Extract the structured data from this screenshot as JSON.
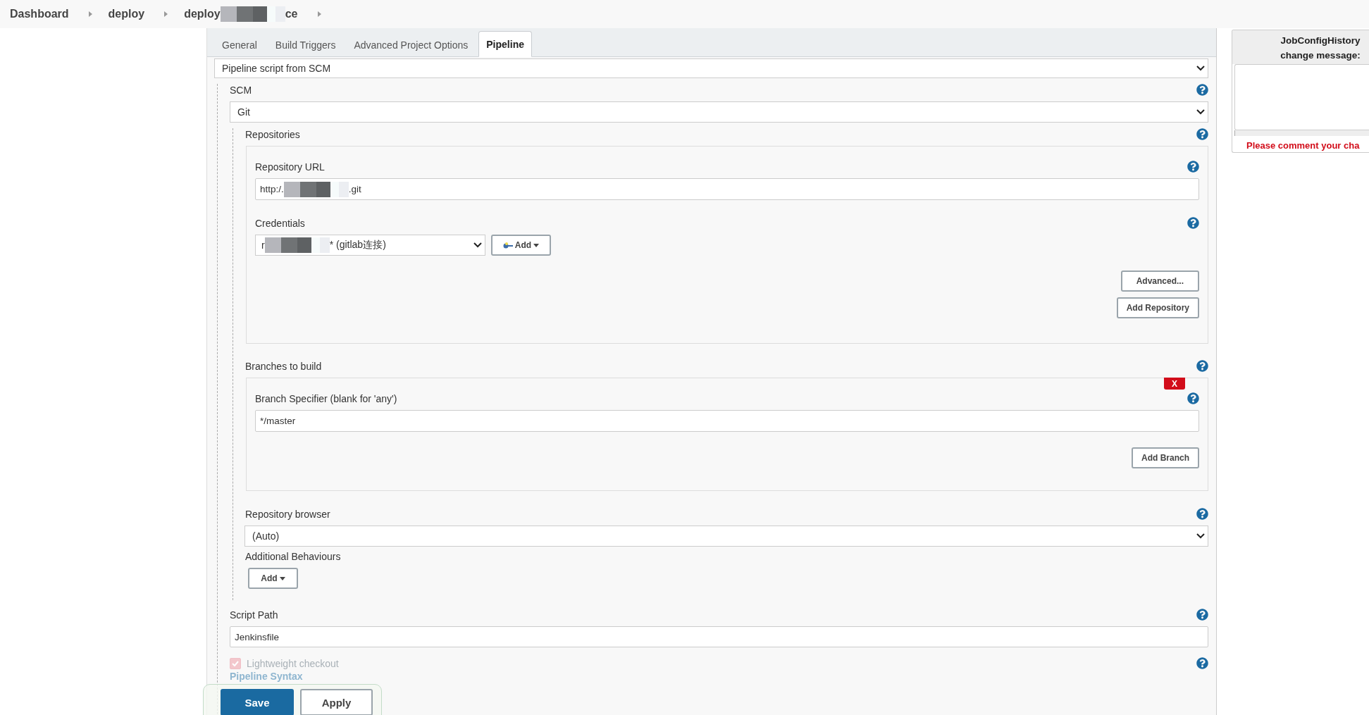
{
  "breadcrumbs": [
    {
      "parts": [
        "Dashboard"
      ]
    },
    {
      "parts": [
        "deploy"
      ]
    },
    {
      "parts": [
        "deploy",
        "ce"
      ]
    }
  ],
  "tabs": [
    {
      "label": "General",
      "selected": false
    },
    {
      "label": "Build Triggers",
      "selected": false
    },
    {
      "label": "Advanced Project Options",
      "selected": false
    },
    {
      "label": "Pipeline",
      "selected": true
    }
  ],
  "definition": {
    "value": "Pipeline script from SCM"
  },
  "scm": {
    "label": "SCM",
    "value": "Git",
    "repositories": {
      "label": "Repositories",
      "url": {
        "label": "Repository URL",
        "value_parts": [
          "http:/.",
          ".git"
        ]
      },
      "credentials": {
        "label": "Credentials",
        "value_parts": [
          "r",
          "* (gitlab连接)"
        ],
        "add_button": "Add"
      },
      "buttons": [
        "Advanced...",
        "Add Repository"
      ]
    },
    "branches": {
      "label": "Branches to build",
      "delete_button": "X",
      "specifier": {
        "label": "Branch Specifier (blank for 'any')",
        "value": "*/master"
      },
      "add_button": "Add Branch"
    },
    "repository_browser": {
      "label": "Repository browser",
      "value": "(Auto)"
    },
    "additional_behaviours": {
      "label": "Additional Behaviours",
      "add_button": "Add"
    }
  },
  "script_path": {
    "label": "Script Path",
    "value": "Jenkinsfile"
  },
  "lightweight_checkout": {
    "label": "Lightweight checkout",
    "checked": true
  },
  "pipeline_syntax": "Pipeline Syntax",
  "actions": {
    "save": "Save",
    "apply": "Apply"
  },
  "history_panel": {
    "title_lines": [
      "JobConfigHistory",
      "change message:"
    ],
    "warning": "Please comment your cha"
  }
}
